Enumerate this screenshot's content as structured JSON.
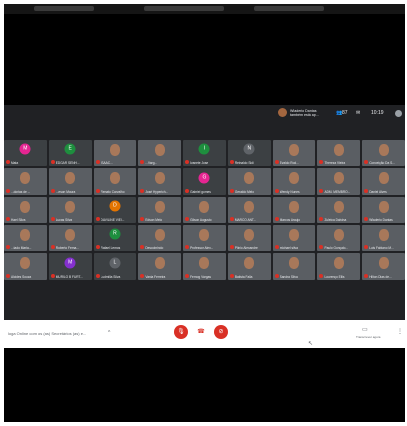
{
  "header": {
    "speaker_name": "Wladerio Dantas",
    "speaker_status": "também está ap...",
    "people_count": "87",
    "time": "10:19"
  },
  "grid": {
    "tiles": [
      {
        "name": "Mata",
        "initial": "M",
        "color": "#e52592",
        "video": false
      },
      {
        "name": "EDGAR SENH...",
        "initial": "E",
        "color": "#1e8e3e",
        "video": false
      },
      {
        "name": "ISAAC...",
        "initial": "",
        "color": "",
        "video": true
      },
      {
        "name": "...Varg...",
        "initial": "",
        "color": "",
        "video": true
      },
      {
        "name": "Ivanete Jose",
        "initial": "I",
        "color": "#1e8e3e",
        "video": false
      },
      {
        "name": "Reinaldo Sidi",
        "initial": "N",
        "color": "#5f6368",
        "video": false
      },
      {
        "name": "Evaldo Rod...",
        "initial": "",
        "color": "",
        "video": true
      },
      {
        "name": "Thereza Vieira",
        "initial": "",
        "color": "",
        "video": true
      },
      {
        "name": "Conceição Da S...",
        "initial": "",
        "color": "",
        "video": true
      },
      {
        "name": "...dorias de ...",
        "initial": "",
        "color": "",
        "video": true
      },
      {
        "name": "...eson Moura",
        "initial": "",
        "color": "",
        "video": true
      },
      {
        "name": "Renato Carvalho",
        "initial": "",
        "color": "",
        "video": true
      },
      {
        "name": "José Hyperich...",
        "initial": "",
        "color": "",
        "video": true
      },
      {
        "name": "Gabriel gomes",
        "initial": "G",
        "color": "#e52592",
        "video": false
      },
      {
        "name": "Geraldo Melo",
        "initial": "",
        "color": "",
        "video": true
      },
      {
        "name": "Wendy Nunes",
        "initial": "",
        "color": "",
        "video": true
      },
      {
        "name": "ADM. MEMBRO...",
        "initial": "",
        "color": "",
        "video": true
      },
      {
        "name": "Daniel Alves",
        "initial": "",
        "color": "",
        "video": true
      },
      {
        "name": "Hael Silva",
        "initial": "",
        "color": "",
        "video": true
      },
      {
        "name": "Lucas Silva",
        "initial": "",
        "color": "",
        "video": true
      },
      {
        "name": "DAVILINE VIEI...",
        "initial": "D",
        "color": "#e37400",
        "video": false
      },
      {
        "name": "Edson Melo",
        "initial": "",
        "color": "",
        "video": true
      },
      {
        "name": "Gilson Augusto",
        "initial": "",
        "color": "",
        "video": true
      },
      {
        "name": "MARCO ANT...",
        "initial": "",
        "color": "",
        "video": true
      },
      {
        "name": "Marcos Araujo",
        "initial": "",
        "color": "",
        "video": true
      },
      {
        "name": "Zuleica Dalvina",
        "initial": "",
        "color": "",
        "video": true
      },
      {
        "name": "Wladerio Dantas",
        "initial": "",
        "color": "",
        "video": true
      },
      {
        "name": "...tado Maria...",
        "initial": "",
        "color": "",
        "video": true
      },
      {
        "name": "Roberto Ferna...",
        "initial": "",
        "color": "",
        "video": true
      },
      {
        "name": "Rafael Lemos",
        "initial": "R",
        "color": "#1e8e3e",
        "video": false
      },
      {
        "name": "Descobrindo",
        "initial": "",
        "color": "",
        "video": true
      },
      {
        "name": "Professor Alex...",
        "initial": "",
        "color": "",
        "video": true
      },
      {
        "name": "Plinio Alexandre",
        "initial": "",
        "color": "",
        "video": true
      },
      {
        "name": "michael silva",
        "initial": "",
        "color": "",
        "video": true
      },
      {
        "name": "Paulo Gonçalo...",
        "initial": "",
        "color": "",
        "video": true
      },
      {
        "name": "Luis Fabiano M...",
        "initial": "",
        "color": "",
        "video": true
      },
      {
        "name": "Alcides Souza",
        "initial": "",
        "color": "",
        "video": true
      },
      {
        "name": "MURILO B FURT...",
        "initial": "M",
        "color": "#8430ce",
        "video": false
      },
      {
        "name": "Ludmilla Silva",
        "initial": "L",
        "color": "#5f6368",
        "video": false
      },
      {
        "name": "Vania Ferreira",
        "initial": "",
        "color": "",
        "video": true
      },
      {
        "name": "Fernog Vargas",
        "initial": "",
        "color": "",
        "video": true
      },
      {
        "name": "Batista Falla",
        "initial": "",
        "color": "",
        "video": true
      },
      {
        "name": "Sandra Silva",
        "initial": "",
        "color": "",
        "video": true
      },
      {
        "name": "Lourenço Ellis",
        "initial": "",
        "color": "",
        "video": true
      },
      {
        "name": "Hilton Dias de...",
        "initial": "",
        "color": "",
        "video": true
      }
    ]
  },
  "bottom": {
    "meeting_title": "loga Online com os (as) Secretários (as) e...",
    "chevron": "^",
    "mic_icon": "mic-off",
    "end_icon": "call-end",
    "cam_icon": "videocam-off",
    "captions_label": "Transcrever agora",
    "more": "⋮"
  }
}
